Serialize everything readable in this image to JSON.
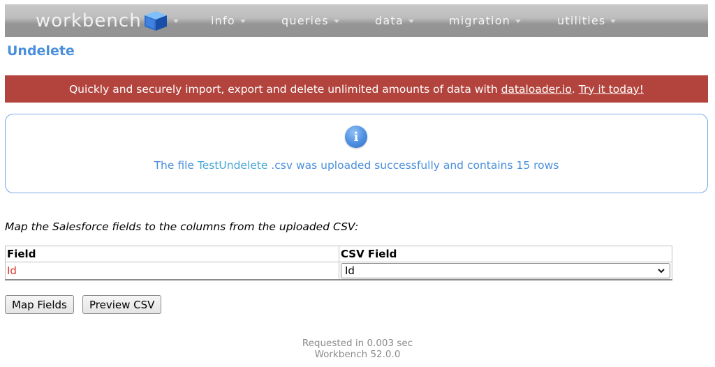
{
  "nav": {
    "brand": "workbench",
    "items": [
      {
        "label": "info"
      },
      {
        "label": "queries"
      },
      {
        "label": "data"
      },
      {
        "label": "migration"
      },
      {
        "label": "utilities"
      }
    ]
  },
  "page": {
    "title": "Undelete"
  },
  "banner": {
    "text": "Quickly and securely import, export and delete unlimited amounts of data with ",
    "link1": "dataloader.io",
    "sep": ". ",
    "link2": "Try it today!",
    "color": "#b3443d"
  },
  "info": {
    "icon": "info-icon",
    "prefix": "The file ",
    "filename": "TestUndelete",
    "suffix": " .csv was uploaded successfully and contains 15 rows"
  },
  "mapping": {
    "instructions": "Map the Salesforce fields to the columns from the uploaded CSV:",
    "headers": [
      "Field",
      "CSV Field"
    ],
    "rows": [
      {
        "field": "Id",
        "csv_field": "Id"
      }
    ]
  },
  "buttons": {
    "map_fields": "Map Fields",
    "preview_csv": "Preview CSV"
  },
  "footer": {
    "requested": "Requested in 0.003 sec",
    "version": "Workbench 52.0.0"
  }
}
